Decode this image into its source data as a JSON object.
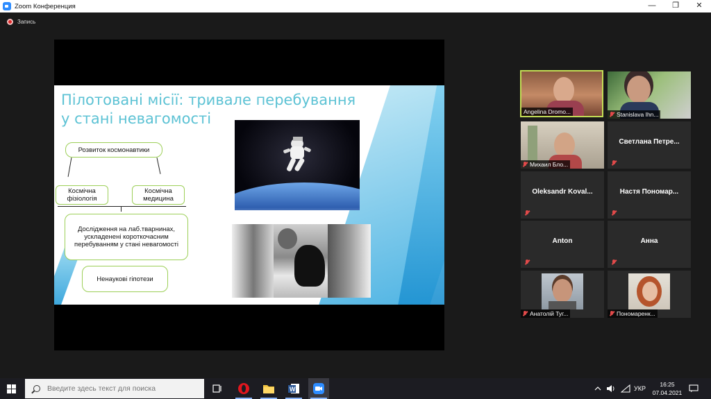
{
  "window": {
    "title": "Zoom Конференция",
    "controls": [
      "—",
      "❐",
      "✕"
    ]
  },
  "recording": {
    "label": "Запись"
  },
  "slide": {
    "title": "Пілотовані місії: тривале перебування у стані невагомості",
    "boxes": {
      "development": "Розвиток космонавтики",
      "physiology": "Космічна фізіологія",
      "medicine": "Космічна медицина",
      "research": "Дослідження на лаб.тварнинах, ускладенені короткочасним перебуванням у стані невагомості",
      "unscientific": "Ненаукові гіпотези"
    }
  },
  "participants": [
    {
      "name": "Angelina Dromo...",
      "video": true,
      "muted": false,
      "active": true
    },
    {
      "name": "Stanislava Ihn...",
      "video": true,
      "muted": true,
      "active": false
    },
    {
      "name": "Михаил Бло...",
      "video": true,
      "muted": true,
      "active": false
    },
    {
      "name": "Светлана Петре...",
      "video": false,
      "muted": true,
      "active": false
    },
    {
      "name": "Oleksandr Koval...",
      "video": false,
      "muted": true,
      "active": false
    },
    {
      "name": "Настя Пономар...",
      "video": false,
      "muted": true,
      "active": false
    },
    {
      "name": "Anton",
      "video": false,
      "muted": true,
      "active": false
    },
    {
      "name": "Анна",
      "video": false,
      "muted": true,
      "active": false
    },
    {
      "name": "Анатолій Туг...",
      "video": true,
      "muted": true,
      "active": false
    },
    {
      "name": "Пономаренк...",
      "video": true,
      "muted": true,
      "active": false
    }
  ],
  "taskbar": {
    "search_placeholder": "Введите здесь текст для поиска",
    "language": "УКР",
    "time": "16:25",
    "date": "07.04.2021"
  },
  "colors": {
    "accent": "#c3de56",
    "slide_title": "#5cc2d4",
    "box_border": "#9ccf57",
    "muted_icon": "#e24a4a"
  }
}
